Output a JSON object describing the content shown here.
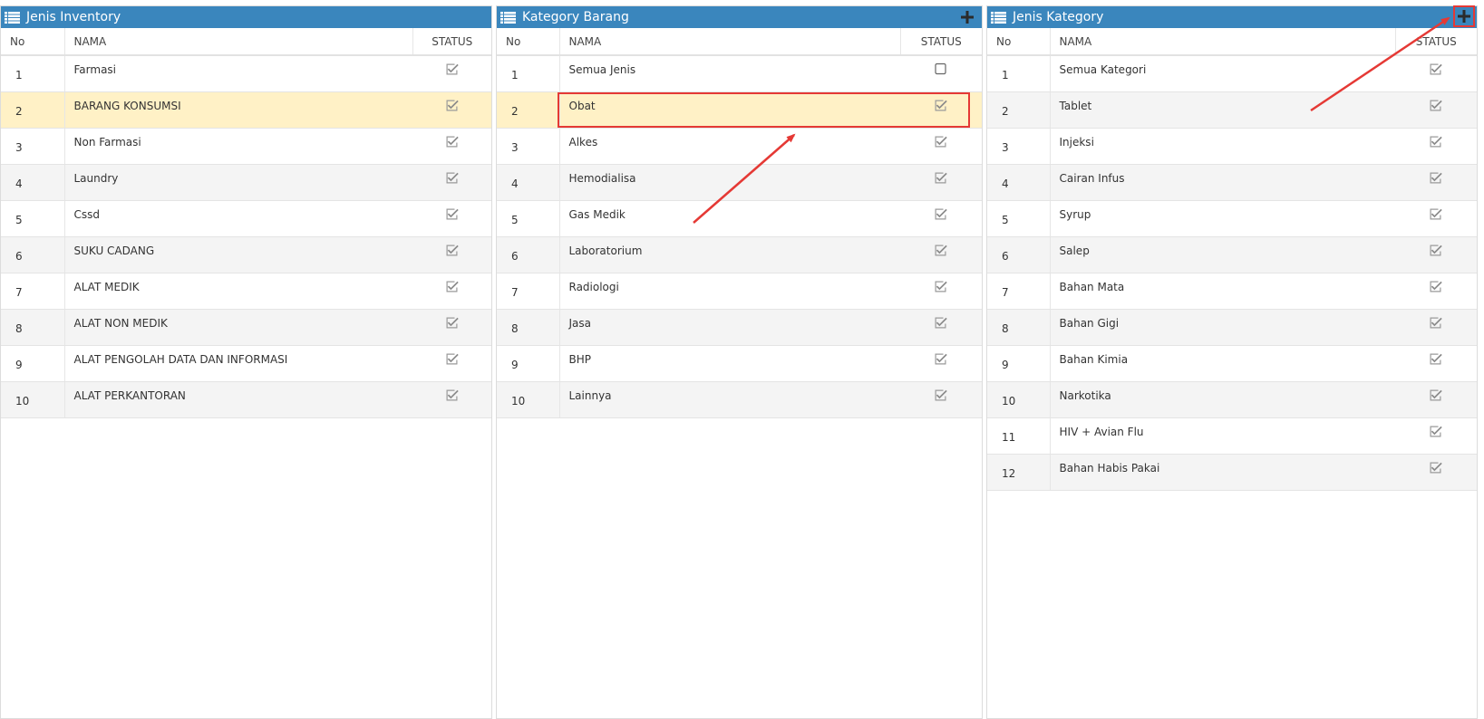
{
  "columns": {
    "no": "No",
    "nama": "NAMA",
    "status": "STATUS"
  },
  "colors": {
    "header": "#3a86bd",
    "selected_row": "#fff1c6",
    "annotation": "#e53935"
  },
  "panels": [
    {
      "title": "Jenis Inventory",
      "has_add": false,
      "selected_index": 1,
      "rows": [
        {
          "no": "1",
          "nama": "Farmasi",
          "status": true
        },
        {
          "no": "2",
          "nama": "BARANG KONSUMSI",
          "status": true
        },
        {
          "no": "3",
          "nama": "Non Farmasi",
          "status": true
        },
        {
          "no": "4",
          "nama": "Laundry",
          "status": true
        },
        {
          "no": "5",
          "nama": "Cssd",
          "status": true
        },
        {
          "no": "6",
          "nama": "SUKU CADANG",
          "status": true
        },
        {
          "no": "7",
          "nama": "ALAT MEDIK",
          "status": true
        },
        {
          "no": "8",
          "nama": "ALAT NON MEDIK",
          "status": true
        },
        {
          "no": "9",
          "nama": "ALAT PENGOLAH DATA DAN INFORMASI",
          "status": true
        },
        {
          "no": "10",
          "nama": "ALAT PERKANTORAN",
          "status": true
        }
      ]
    },
    {
      "title": "Kategory Barang",
      "has_add": true,
      "selected_index": 1,
      "rows": [
        {
          "no": "1",
          "nama": "Semua Jenis",
          "status": false
        },
        {
          "no": "2",
          "nama": "Obat",
          "status": true
        },
        {
          "no": "3",
          "nama": "Alkes",
          "status": true
        },
        {
          "no": "4",
          "nama": "Hemodialisa",
          "status": true
        },
        {
          "no": "5",
          "nama": "Gas Medik",
          "status": true
        },
        {
          "no": "6",
          "nama": "Laboratorium",
          "status": true
        },
        {
          "no": "7",
          "nama": "Radiologi",
          "status": true
        },
        {
          "no": "8",
          "nama": "Jasa",
          "status": true
        },
        {
          "no": "9",
          "nama": "BHP",
          "status": true
        },
        {
          "no": "10",
          "nama": "Lainnya",
          "status": true
        }
      ]
    },
    {
      "title": "Jenis Kategory",
      "has_add": true,
      "selected_index": -1,
      "rows": [
        {
          "no": "1",
          "nama": "Semua Kategori",
          "status": true
        },
        {
          "no": "2",
          "nama": "Tablet",
          "status": true
        },
        {
          "no": "3",
          "nama": "Injeksi",
          "status": true
        },
        {
          "no": "4",
          "nama": "Cairan Infus",
          "status": true
        },
        {
          "no": "5",
          "nama": "Syrup",
          "status": true
        },
        {
          "no": "6",
          "nama": "Salep",
          "status": true
        },
        {
          "no": "7",
          "nama": "Bahan Mata",
          "status": true
        },
        {
          "no": "8",
          "nama": "Bahan Gigi",
          "status": true
        },
        {
          "no": "9",
          "nama": "Bahan Kimia",
          "status": true
        },
        {
          "no": "10",
          "nama": "Narkotika",
          "status": true
        },
        {
          "no": "11",
          "nama": "HIV + Avian Flu",
          "status": true
        },
        {
          "no": "12",
          "nama": "Bahan Habis Pakai",
          "status": true
        }
      ]
    }
  ]
}
